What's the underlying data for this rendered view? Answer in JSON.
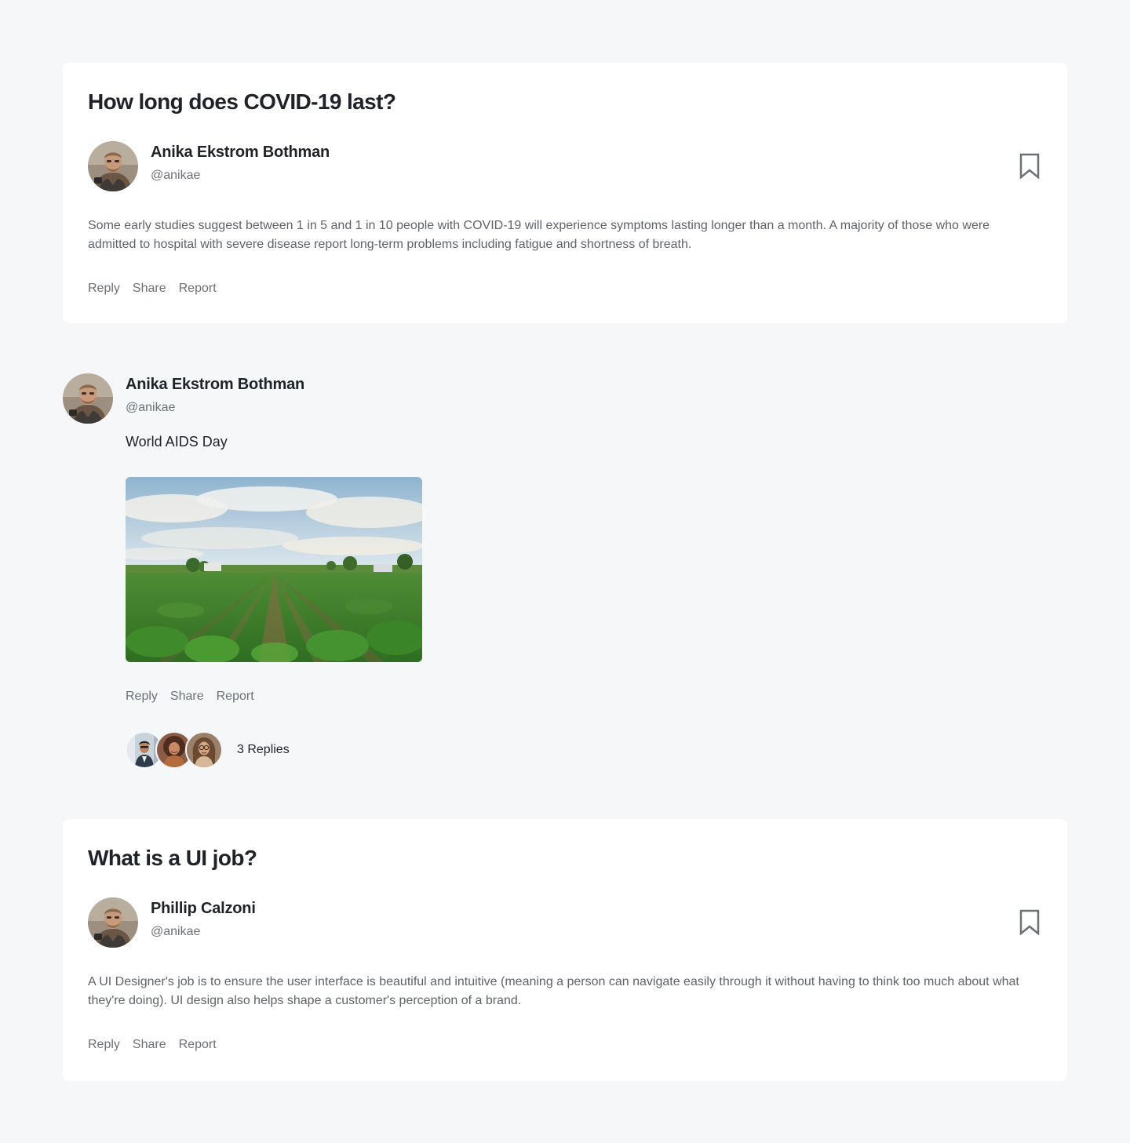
{
  "questions": [
    {
      "title": "How long does COVID-19 last?",
      "author": {
        "name": "Anika Ekstrom Bothman",
        "handle": "@anikae"
      },
      "body": "Some early studies suggest between 1 in 5 and 1 in 10 people with COVID-19 will experience symptoms lasting longer than a month. A majority of those who were admitted to hospital with severe disease report long-term problems including fatigue and shortness of breath.",
      "actions": {
        "reply": "Reply",
        "share": "Share",
        "report": "Report"
      },
      "bookmark_icon": "bookmark-icon"
    },
    {
      "title": "What is a UI job?",
      "author": {
        "name": "Phillip Calzoni",
        "handle": "@anikae"
      },
      "body": "A UI Designer's job is to ensure the user interface is beautiful and intuitive (meaning a person can navigate easily through it without having to think too much about what they're doing). UI design also helps shape a customer's perception of a brand.",
      "actions": {
        "reply": "Reply",
        "share": "Share",
        "report": "Report"
      },
      "bookmark_icon": "bookmark-icon"
    }
  ],
  "post": {
    "author": {
      "name": "Anika Ekstrom Bothman",
      "handle": "@anikae"
    },
    "text": "World AIDS Day",
    "image": "farm-field-photo",
    "actions": {
      "reply": "Reply",
      "share": "Share",
      "report": "Report"
    },
    "replies_label": "3 Replies"
  },
  "colors": {
    "background": "#f6f7f9",
    "card": "#ffffff",
    "heading": "#1f2329",
    "muted": "#6b7079"
  }
}
